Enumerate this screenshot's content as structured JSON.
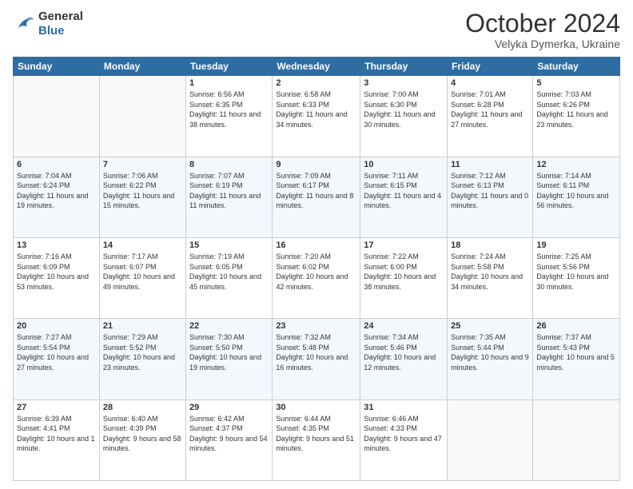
{
  "header": {
    "logo": {
      "general": "General",
      "blue": "Blue"
    },
    "title": "October 2024",
    "subtitle": "Velyka Dymerka, Ukraine"
  },
  "weekdays": [
    "Sunday",
    "Monday",
    "Tuesday",
    "Wednesday",
    "Thursday",
    "Friday",
    "Saturday"
  ],
  "weeks": [
    [
      {
        "day": "",
        "sunrise": "",
        "sunset": "",
        "daylight": ""
      },
      {
        "day": "",
        "sunrise": "",
        "sunset": "",
        "daylight": ""
      },
      {
        "day": "1",
        "sunrise": "Sunrise: 6:56 AM",
        "sunset": "Sunset: 6:35 PM",
        "daylight": "Daylight: 11 hours and 38 minutes."
      },
      {
        "day": "2",
        "sunrise": "Sunrise: 6:58 AM",
        "sunset": "Sunset: 6:33 PM",
        "daylight": "Daylight: 11 hours and 34 minutes."
      },
      {
        "day": "3",
        "sunrise": "Sunrise: 7:00 AM",
        "sunset": "Sunset: 6:30 PM",
        "daylight": "Daylight: 11 hours and 30 minutes."
      },
      {
        "day": "4",
        "sunrise": "Sunrise: 7:01 AM",
        "sunset": "Sunset: 6:28 PM",
        "daylight": "Daylight: 11 hours and 27 minutes."
      },
      {
        "day": "5",
        "sunrise": "Sunrise: 7:03 AM",
        "sunset": "Sunset: 6:26 PM",
        "daylight": "Daylight: 11 hours and 23 minutes."
      }
    ],
    [
      {
        "day": "6",
        "sunrise": "Sunrise: 7:04 AM",
        "sunset": "Sunset: 6:24 PM",
        "daylight": "Daylight: 11 hours and 19 minutes."
      },
      {
        "day": "7",
        "sunrise": "Sunrise: 7:06 AM",
        "sunset": "Sunset: 6:22 PM",
        "daylight": "Daylight: 11 hours and 15 minutes."
      },
      {
        "day": "8",
        "sunrise": "Sunrise: 7:07 AM",
        "sunset": "Sunset: 6:19 PM",
        "daylight": "Daylight: 11 hours and 11 minutes."
      },
      {
        "day": "9",
        "sunrise": "Sunrise: 7:09 AM",
        "sunset": "Sunset: 6:17 PM",
        "daylight": "Daylight: 11 hours and 8 minutes."
      },
      {
        "day": "10",
        "sunrise": "Sunrise: 7:11 AM",
        "sunset": "Sunset: 6:15 PM",
        "daylight": "Daylight: 11 hours and 4 minutes."
      },
      {
        "day": "11",
        "sunrise": "Sunrise: 7:12 AM",
        "sunset": "Sunset: 6:13 PM",
        "daylight": "Daylight: 11 hours and 0 minutes."
      },
      {
        "day": "12",
        "sunrise": "Sunrise: 7:14 AM",
        "sunset": "Sunset: 6:11 PM",
        "daylight": "Daylight: 10 hours and 56 minutes."
      }
    ],
    [
      {
        "day": "13",
        "sunrise": "Sunrise: 7:16 AM",
        "sunset": "Sunset: 6:09 PM",
        "daylight": "Daylight: 10 hours and 53 minutes."
      },
      {
        "day": "14",
        "sunrise": "Sunrise: 7:17 AM",
        "sunset": "Sunset: 6:07 PM",
        "daylight": "Daylight: 10 hours and 49 minutes."
      },
      {
        "day": "15",
        "sunrise": "Sunrise: 7:19 AM",
        "sunset": "Sunset: 6:05 PM",
        "daylight": "Daylight: 10 hours and 45 minutes."
      },
      {
        "day": "16",
        "sunrise": "Sunrise: 7:20 AM",
        "sunset": "Sunset: 6:02 PM",
        "daylight": "Daylight: 10 hours and 42 minutes."
      },
      {
        "day": "17",
        "sunrise": "Sunrise: 7:22 AM",
        "sunset": "Sunset: 6:00 PM",
        "daylight": "Daylight: 10 hours and 38 minutes."
      },
      {
        "day": "18",
        "sunrise": "Sunrise: 7:24 AM",
        "sunset": "Sunset: 5:58 PM",
        "daylight": "Daylight: 10 hours and 34 minutes."
      },
      {
        "day": "19",
        "sunrise": "Sunrise: 7:25 AM",
        "sunset": "Sunset: 5:56 PM",
        "daylight": "Daylight: 10 hours and 30 minutes."
      }
    ],
    [
      {
        "day": "20",
        "sunrise": "Sunrise: 7:27 AM",
        "sunset": "Sunset: 5:54 PM",
        "daylight": "Daylight: 10 hours and 27 minutes."
      },
      {
        "day": "21",
        "sunrise": "Sunrise: 7:29 AM",
        "sunset": "Sunset: 5:52 PM",
        "daylight": "Daylight: 10 hours and 23 minutes."
      },
      {
        "day": "22",
        "sunrise": "Sunrise: 7:30 AM",
        "sunset": "Sunset: 5:50 PM",
        "daylight": "Daylight: 10 hours and 19 minutes."
      },
      {
        "day": "23",
        "sunrise": "Sunrise: 7:32 AM",
        "sunset": "Sunset: 5:48 PM",
        "daylight": "Daylight: 10 hours and 16 minutes."
      },
      {
        "day": "24",
        "sunrise": "Sunrise: 7:34 AM",
        "sunset": "Sunset: 5:46 PM",
        "daylight": "Daylight: 10 hours and 12 minutes."
      },
      {
        "day": "25",
        "sunrise": "Sunrise: 7:35 AM",
        "sunset": "Sunset: 5:44 PM",
        "daylight": "Daylight: 10 hours and 9 minutes."
      },
      {
        "day": "26",
        "sunrise": "Sunrise: 7:37 AM",
        "sunset": "Sunset: 5:43 PM",
        "daylight": "Daylight: 10 hours and 5 minutes."
      }
    ],
    [
      {
        "day": "27",
        "sunrise": "Sunrise: 6:39 AM",
        "sunset": "Sunset: 4:41 PM",
        "daylight": "Daylight: 10 hours and 1 minute."
      },
      {
        "day": "28",
        "sunrise": "Sunrise: 6:40 AM",
        "sunset": "Sunset: 4:39 PM",
        "daylight": "Daylight: 9 hours and 58 minutes."
      },
      {
        "day": "29",
        "sunrise": "Sunrise: 6:42 AM",
        "sunset": "Sunset: 4:37 PM",
        "daylight": "Daylight: 9 hours and 54 minutes."
      },
      {
        "day": "30",
        "sunrise": "Sunrise: 6:44 AM",
        "sunset": "Sunset: 4:35 PM",
        "daylight": "Daylight: 9 hours and 51 minutes."
      },
      {
        "day": "31",
        "sunrise": "Sunrise: 6:46 AM",
        "sunset": "Sunset: 4:33 PM",
        "daylight": "Daylight: 9 hours and 47 minutes."
      },
      {
        "day": "",
        "sunrise": "",
        "sunset": "",
        "daylight": ""
      },
      {
        "day": "",
        "sunrise": "",
        "sunset": "",
        "daylight": ""
      }
    ]
  ]
}
